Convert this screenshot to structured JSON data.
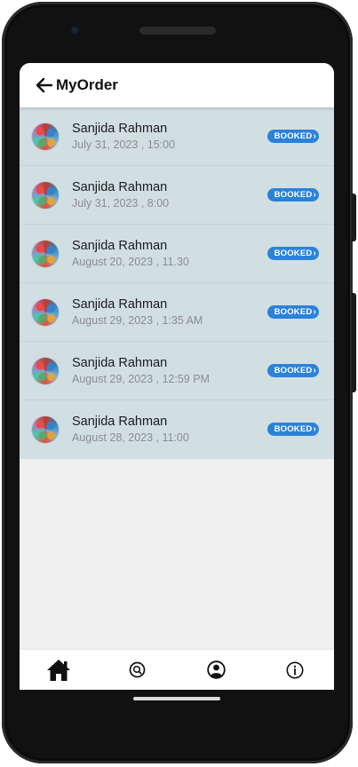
{
  "header": {
    "title": "MyOrder"
  },
  "orders": [
    {
      "name": "Sanjida Rahman",
      "datetime": "July 31, 2023 ,  15:00",
      "status": "BOOKED"
    },
    {
      "name": "Sanjida Rahman",
      "datetime": "July 31, 2023 ,  8:00",
      "status": "BOOKED"
    },
    {
      "name": "Sanjida Rahman",
      "datetime": "August 20, 2023 ,  11.30",
      "status": "BOOKED"
    },
    {
      "name": "Sanjida Rahman",
      "datetime": "August 29, 2023 ,  1:35 AM",
      "status": "BOOKED"
    },
    {
      "name": "Sanjida Rahman",
      "datetime": "August 29, 2023 ,  12:59 PM",
      "status": "BOOKED"
    },
    {
      "name": "Sanjida Rahman",
      "datetime": "August 28, 2023 ,  11:00",
      "status": "BOOKED"
    }
  ],
  "bottom_nav": [
    {
      "icon": "home-icon",
      "active": true
    },
    {
      "icon": "search-icon",
      "active": false
    },
    {
      "icon": "profile-icon",
      "active": false
    },
    {
      "icon": "info-icon",
      "active": false
    }
  ],
  "colors": {
    "list_background": "#d1dfe3",
    "badge": "#2b82d9",
    "screen_background": "#f0f0f0"
  }
}
